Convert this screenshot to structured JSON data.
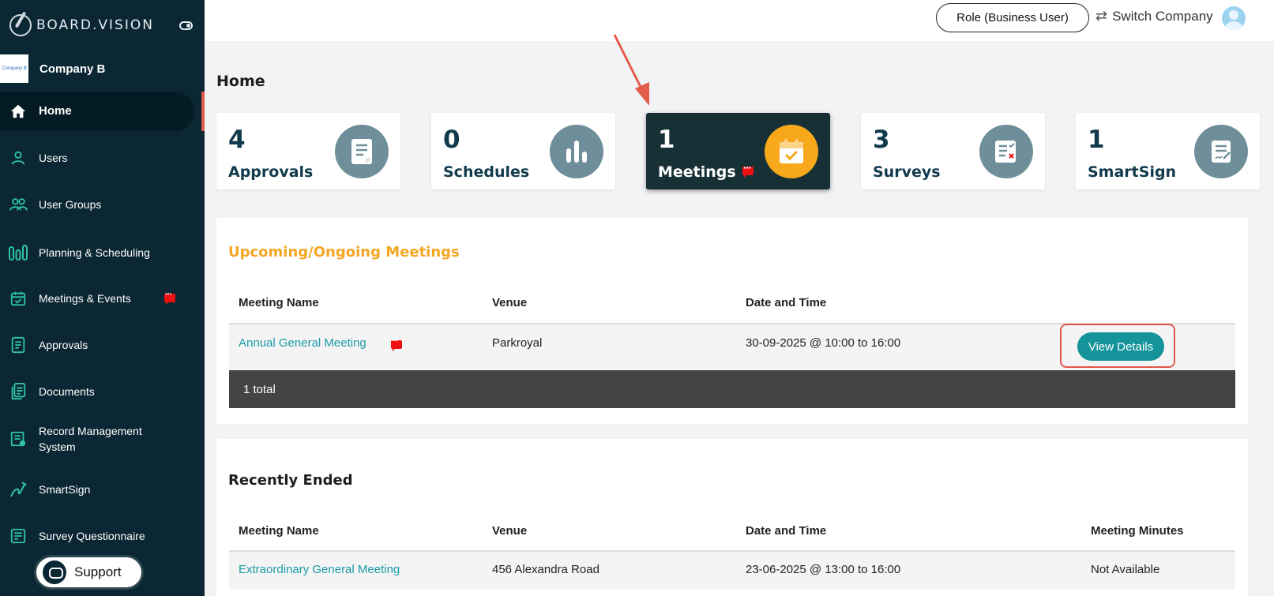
{
  "app": {
    "logo_text": "BOARD.VISION"
  },
  "company": {
    "logo_text": "Company B",
    "name": "Company B"
  },
  "sidebar": {
    "items": [
      {
        "label": "Home",
        "icon": "home-icon"
      },
      {
        "label": "Users",
        "icon": "user-icon"
      },
      {
        "label": "User Groups",
        "icon": "users-icon"
      },
      {
        "label": "Planning & Scheduling",
        "icon": "bars-icon"
      },
      {
        "label": "Meetings & Events",
        "icon": "calendar-icon"
      },
      {
        "label": "Approvals",
        "icon": "document-icon"
      },
      {
        "label": "Documents",
        "icon": "documents-icon"
      },
      {
        "label": "Record Management System",
        "icon": "record-icon"
      },
      {
        "label": "SmartSign",
        "icon": "signature-icon"
      },
      {
        "label": "Survey Questionnaire",
        "icon": "survey-icon"
      }
    ],
    "support_label": "Support"
  },
  "topbar": {
    "role_label": "Role (Business User)",
    "switch_label": "Switch Company"
  },
  "page": {
    "title": "Home"
  },
  "stats": [
    {
      "num": "4",
      "label": "Approvals"
    },
    {
      "num": "0",
      "label": "Schedules"
    },
    {
      "num": "1",
      "label": "Meetings"
    },
    {
      "num": "3",
      "label": "Surveys"
    },
    {
      "num": "1",
      "label": "SmartSign"
    }
  ],
  "upcoming": {
    "title": "Upcoming/Ongoing Meetings",
    "headers": [
      "Meeting Name",
      "Venue",
      "Date and Time"
    ],
    "rows": [
      {
        "name": "Annual General Meeting",
        "venue": "Parkroyal",
        "datetime": "30-09-2025 @ 10:00 to 16:00",
        "action": "View Details"
      }
    ],
    "total": "1 total"
  },
  "recent": {
    "title": "Recently Ended",
    "headers": [
      "Meeting Name",
      "Venue",
      "Date and Time",
      "Meeting Minutes"
    ],
    "rows": [
      {
        "name": "Extraordinary General Meeting",
        "venue": "456 Alexandra Road",
        "datetime": "23-06-2025 @ 13:00 to 16:00",
        "minutes": "Not Available"
      }
    ]
  },
  "colors": {
    "sidebar": "#0b2733",
    "accent_orange": "#f5a623",
    "teal": "#14949a",
    "highlight_red": "#e0574a"
  }
}
